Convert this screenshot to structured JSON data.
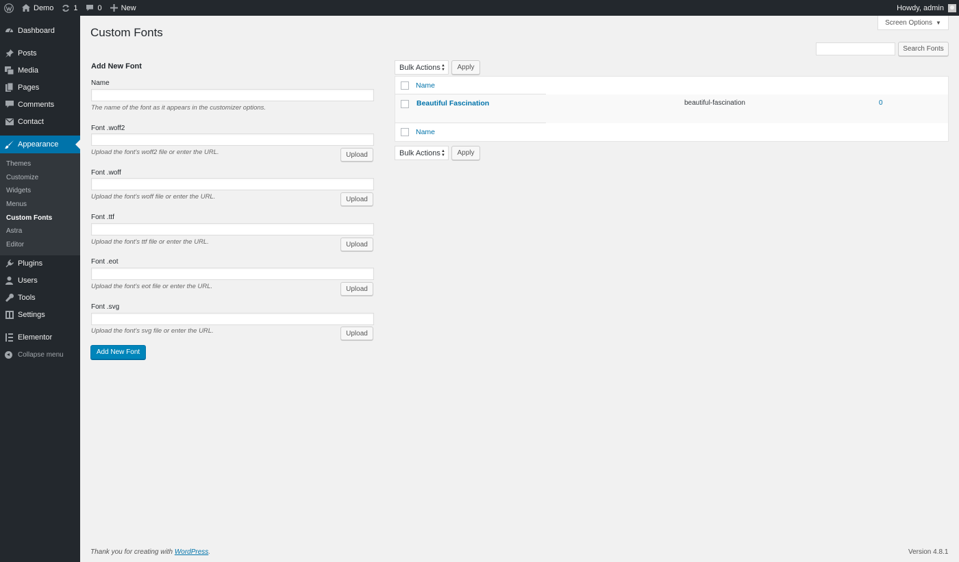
{
  "admin_bar": {
    "site_name": "Demo",
    "updates_count": "1",
    "comments_count": "0",
    "new_label": "New",
    "greeting": "Howdy, admin"
  },
  "sidebar": {
    "top_items": [
      {
        "label": "Dashboard",
        "icon": "dashboard-icon"
      }
    ],
    "items": [
      {
        "label": "Posts",
        "icon": "pin-icon"
      },
      {
        "label": "Media",
        "icon": "media-icon"
      },
      {
        "label": "Pages",
        "icon": "pages-icon"
      },
      {
        "label": "Comments",
        "icon": "comment-icon"
      },
      {
        "label": "Contact",
        "icon": "mail-icon"
      }
    ],
    "active_item": {
      "label": "Appearance",
      "icon": "brush-icon"
    },
    "submenu": [
      "Themes",
      "Customize",
      "Widgets",
      "Menus",
      "Custom Fonts",
      "Astra",
      "Editor"
    ],
    "current_submenu": "Custom Fonts",
    "lower_items": [
      {
        "label": "Plugins",
        "icon": "plug-icon"
      },
      {
        "label": "Users",
        "icon": "user-icon"
      },
      {
        "label": "Tools",
        "icon": "wrench-icon"
      },
      {
        "label": "Settings",
        "icon": "settings-icon"
      }
    ],
    "elementor": {
      "label": "Elementor",
      "icon": "elementor-icon"
    },
    "collapse_label": "Collapse menu",
    "accent_color": "#0073aa"
  },
  "page": {
    "title": "Custom Fonts",
    "screen_options": "Screen Options",
    "search_button": "Search Fonts",
    "search_value": ""
  },
  "form": {
    "title": "Add New Font",
    "name_label": "Name",
    "name_value": "",
    "name_desc": "The name of the font as it appears in the customizer options.",
    "upload_label": "Upload",
    "fields": [
      {
        "label": "Font .woff2",
        "desc": "Upload the font's woff2 file or enter the URL.",
        "value": ""
      },
      {
        "label": "Font .woff",
        "desc": "Upload the font's woff file or enter the URL.",
        "value": ""
      },
      {
        "label": "Font .ttf",
        "desc": "Upload the font's ttf file or enter the URL.",
        "value": ""
      },
      {
        "label": "Font .eot",
        "desc": "Upload the font's eot file or enter the URL.",
        "value": ""
      },
      {
        "label": "Font .svg",
        "desc": "Upload the font's svg file or enter the URL.",
        "value": ""
      }
    ],
    "submit_label": "Add New Font"
  },
  "table": {
    "bulk_actions_label": "Bulk Actions",
    "apply_label": "Apply",
    "column_name": "Name",
    "rows": [
      {
        "name": "Beautiful Fascination",
        "slug": "beautiful-fascination",
        "count": "0"
      }
    ]
  },
  "footer": {
    "thanks_prefix": "Thank you for creating with ",
    "thanks_link": "WordPress",
    "thanks_suffix": ".",
    "version": "Version 4.8.1"
  }
}
